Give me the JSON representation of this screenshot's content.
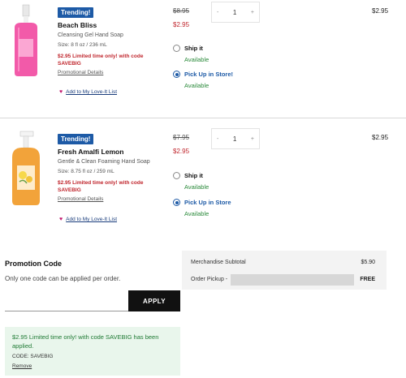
{
  "items": [
    {
      "badge": "Trending!",
      "name": "Beach Bliss",
      "description": "Cleansing Gel Hand Soap",
      "size": "Size: 8 fl oz / 236 mL",
      "deal": "$2.95 Limited time only! with code SAVEBIG",
      "promo_link": "Promotional Details",
      "love_it": "Add to My Love-It List",
      "original_price": "$8.95",
      "sale_price": "$2.95",
      "qty_minus": "-",
      "qty": "1",
      "qty_plus": "+",
      "line_total": "$2.95",
      "ship_label": "Ship it",
      "ship_status": "Available",
      "pickup_label": "Pick Up in Store!",
      "pickup_status": "Available",
      "selected_option": "pickup"
    },
    {
      "badge": "Trending!",
      "name": "Fresh Amalfi Lemon",
      "description": "Gentle & Clean Foaming Hand Soap",
      "size": "Size: 8.75 fl oz / 259 mL",
      "deal": "$2.95 Limited time only! with code SAVEBIG",
      "promo_link": "Promotional Details",
      "love_it": "Add to My Love-It List",
      "original_price": "$7.95",
      "sale_price": "$2.95",
      "qty_minus": "-",
      "qty": "1",
      "qty_plus": "+",
      "line_total": "$2.95",
      "ship_label": "Ship it",
      "ship_status": "Available",
      "pickup_label": "Pick Up in Store",
      "pickup_status": "Available",
      "selected_option": "pickup"
    }
  ],
  "promotion": {
    "title": "Promotion Code",
    "note": "Only one code can be applied per order.",
    "input_value": "",
    "apply_label": "APPLY",
    "applied_message": "$2.95 Limited time only! with code SAVEBIG has been applied.",
    "applied_code": "CODE: SAVEBIG",
    "remove_label": "Remove"
  },
  "summary": {
    "subtotal_label": "Merchandise Subtotal",
    "subtotal_value": "$5.90",
    "pickup_label": "Order Pickup -",
    "pickup_value": "FREE"
  },
  "colors": {
    "accent_blue": "#1d5aa6",
    "sale_red": "#c0262d",
    "available_green": "#2a8a3a",
    "applied_bg": "#e9f6ec"
  }
}
